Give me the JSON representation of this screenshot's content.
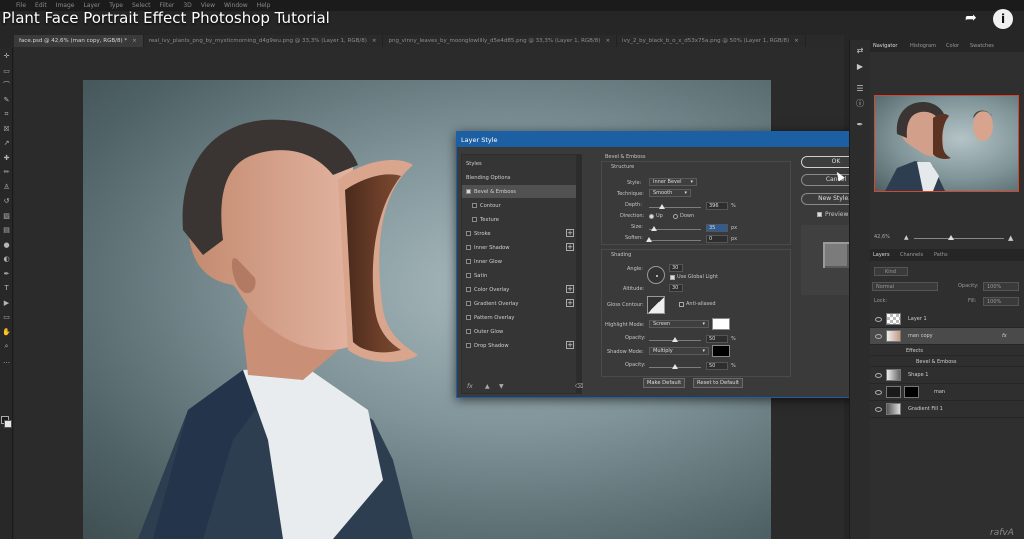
{
  "video": {
    "title": "Plant Face Portrait Effect Photoshop Tutorial"
  },
  "menu": [
    "File",
    "Edit",
    "Image",
    "Layer",
    "Type",
    "Select",
    "Filter",
    "3D",
    "View",
    "Window",
    "Help"
  ],
  "tabs": [
    {
      "label": "face.psd @ 42,6% (man copy, RGB/8) *"
    },
    {
      "label": "real_ivy_plants_png_by_mysticmorning_d4g9wu.png @ 33,3% (Layer 1, RGB/8)"
    },
    {
      "label": "png_vinny_leaves_by_moonglowlilly_d5e4d85.png @ 33,3% (Layer 1, RGB/8)"
    },
    {
      "label": "ivy_2_by_black_b_o_x_d53x75a.png @ 50% (Layer 1, RGB/8)"
    }
  ],
  "dialog": {
    "title": "Layer Style",
    "styles": [
      {
        "label": "Styles",
        "checkbox": false,
        "checked": false,
        "plus": false,
        "indent": false,
        "selected": false
      },
      {
        "label": "Blending Options",
        "checkbox": false,
        "checked": false,
        "plus": false,
        "indent": false,
        "selected": false
      },
      {
        "label": "Bevel & Emboss",
        "checkbox": true,
        "checked": true,
        "plus": false,
        "indent": false,
        "selected": true
      },
      {
        "label": "Contour",
        "checkbox": true,
        "checked": false,
        "plus": false,
        "indent": true,
        "selected": false
      },
      {
        "label": "Texture",
        "checkbox": true,
        "checked": false,
        "plus": false,
        "indent": true,
        "selected": false
      },
      {
        "label": "Stroke",
        "checkbox": true,
        "checked": false,
        "plus": true,
        "indent": false,
        "selected": false
      },
      {
        "label": "Inner Shadow",
        "checkbox": true,
        "checked": false,
        "plus": true,
        "indent": false,
        "selected": false
      },
      {
        "label": "Inner Glow",
        "checkbox": true,
        "checked": false,
        "plus": false,
        "indent": false,
        "selected": false
      },
      {
        "label": "Satin",
        "checkbox": true,
        "checked": false,
        "plus": false,
        "indent": false,
        "selected": false
      },
      {
        "label": "Color Overlay",
        "checkbox": true,
        "checked": false,
        "plus": true,
        "indent": false,
        "selected": false
      },
      {
        "label": "Gradient Overlay",
        "checkbox": true,
        "checked": false,
        "plus": true,
        "indent": false,
        "selected": false
      },
      {
        "label": "Pattern Overlay",
        "checkbox": true,
        "checked": false,
        "plus": false,
        "indent": false,
        "selected": false
      },
      {
        "label": "Outer Glow",
        "checkbox": true,
        "checked": false,
        "plus": false,
        "indent": false,
        "selected": false
      },
      {
        "label": "Drop Shadow",
        "checkbox": true,
        "checked": false,
        "plus": true,
        "indent": false,
        "selected": false
      }
    ],
    "bevel": {
      "section_title": "Bevel & Emboss",
      "structure_title": "Structure",
      "style_label": "Style:",
      "style_value": "Inner Bevel",
      "technique_label": "Technique:",
      "technique_value": "Smooth",
      "depth_label": "Depth:",
      "depth_value": "396",
      "depth_unit": "%",
      "depth_fraction": 0.25,
      "direction_label": "Direction:",
      "dir_up": "Up",
      "dir_down": "Down",
      "size_label": "Size:",
      "size_value": "35",
      "size_unit": "px",
      "size_fraction": 0.1,
      "soften_label": "Soften:",
      "soften_value": "0",
      "soften_unit": "px",
      "soften_fraction": 0.0,
      "shading_title": "Shading",
      "angle_label": "Angle:",
      "angle_value": "30",
      "global_light_label": "Use Global Light",
      "altitude_label": "Altitude:",
      "altitude_value": "30",
      "gloss_label": "Gloss Contour:",
      "anti_aliased_label": "Anti-aliased",
      "highlight_label": "Highlight Mode:",
      "highlight_value": "Screen",
      "highlight_color": "#ffffff",
      "hl_opacity_label": "Opacity:",
      "hl_opacity_value": "50",
      "hl_opacity_unit": "%",
      "hl_opacity_fraction": 0.5,
      "shadow_label": "Shadow Mode:",
      "shadow_value": "Multiply",
      "shadow_color": "#000000",
      "sh_opacity_label": "Opacity:",
      "sh_opacity_value": "50",
      "sh_opacity_unit": "%",
      "sh_opacity_fraction": 0.5,
      "make_default": "Make Default",
      "reset_default": "Reset to Default"
    },
    "buttons": {
      "ok": "OK",
      "cancel": "Cancel",
      "new_style": "New Style...",
      "preview": "Preview"
    },
    "footer": {
      "fx": "fx"
    }
  },
  "panels": {
    "top_tabs": [
      "Navigator",
      "Histogram",
      "Color",
      "Swatches"
    ],
    "zoom": "42,6%",
    "layer_tabs": [
      "Layers",
      "Channels",
      "Paths"
    ],
    "kind_label": "Kind",
    "blend_mode": "Normal",
    "opacity_label": "Opacity:",
    "opacity_value": "100%",
    "lock_label": "Lock:",
    "fill_label": "Fill:",
    "fill_value": "100%",
    "layers": [
      {
        "name": "Layer 1",
        "thumb": "transparent",
        "effects": false,
        "selected": false,
        "indent": 0
      },
      {
        "name": "man copy",
        "thumb": "face",
        "effects": true,
        "selected": true,
        "indent": 0
      },
      {
        "name": "Effects",
        "thumb": "",
        "effects": false,
        "selected": false,
        "indent": 1
      },
      {
        "name": "Bevel & Emboss",
        "thumb": "",
        "effects": false,
        "selected": false,
        "indent": 2
      },
      {
        "name": "Shape 1",
        "thumb": "shape",
        "effects": false,
        "selected": false,
        "indent": 0
      },
      {
        "name": "man",
        "thumb": "face-mask",
        "effects": false,
        "selected": false,
        "indent": 0
      },
      {
        "name": "Gradient Fill 1",
        "thumb": "gradient",
        "effects": false,
        "selected": false,
        "indent": 0
      }
    ]
  },
  "watermark": "rafvA",
  "colors": {
    "accent": "#1d5fa3",
    "nav_border": "#d9452b"
  }
}
